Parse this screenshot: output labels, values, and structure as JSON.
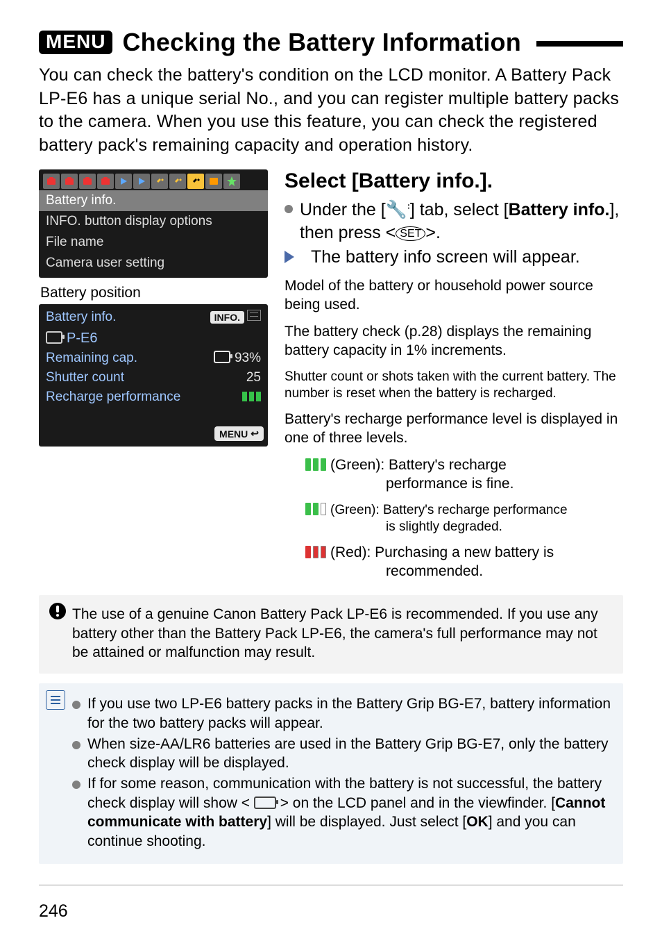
{
  "header": {
    "menu_badge": "MENU",
    "title": "Checking the Battery Information"
  },
  "intro": "You can check the battery's condition on the LCD monitor. A Battery Pack LP-E6 has a unique serial No., and you can register multiple battery packs to the camera. When you use this feature, you can check the registered battery pack's remaining capacity and operation history.",
  "menu_screen": {
    "items": [
      "Battery info.",
      "INFO. button display options",
      "File name",
      "Camera user setting"
    ],
    "selected_index": 0
  },
  "battery_position_label": "Battery position",
  "info_screen": {
    "title": "Battery info.",
    "info_label": "INFO.",
    "model_label": "P-E6",
    "remaining_label": "Remaining cap.",
    "remaining_value": "93%",
    "shutter_label": "Shutter count",
    "shutter_value": "25",
    "recharge_label": "Recharge performance",
    "menu_label": "MENU"
  },
  "step": {
    "title": "Select [Battery info.].",
    "line1_pre": "Under the [",
    "line1_mid": "] tab, select [",
    "line1_bold": "Battery info.",
    "line1_post": "], then press <",
    "line1_end": ">.",
    "line2": "The battery info screen will appear."
  },
  "annotations": {
    "model": "Model of the battery or household power source being used.",
    "remaining": "The battery check (p.28) displays the remaining battery capacity in 1% increments.",
    "shutter": "Shutter count or shots taken with the current battery. The number is reset when the battery is recharged.",
    "recharge_intro": "Battery's recharge performance level is displayed in one of three levels.",
    "lvl_fine_a": "(Green): Battery's recharge",
    "lvl_fine_b": "performance is fine.",
    "lvl_deg_a": "(Green): Battery's recharge performance",
    "lvl_deg_b": "is slightly degraded.",
    "lvl_red_a": "(Red): Purchasing a new battery is",
    "lvl_red_b": "recommended."
  },
  "note_warning": "The use of a genuine Canon Battery Pack LP-E6 is recommended. If you use any battery other than the Battery Pack LP-E6, the camera's full performance may not be attained or malfunction may result.",
  "tips": {
    "t1": "If you use two LP-E6 battery packs in the Battery Grip BG-E7, battery information for the two battery packs will appear.",
    "t2": "When size-AA/LR6 batteries are used in the Battery Grip BG-E7, only the battery check display will be displayed.",
    "t3_a": "If for some reason, communication with the battery is not successful, the battery check display will show < ",
    "t3_b": " > on the LCD panel and in the viewfinder. [",
    "t3_bold": "Cannot communicate with battery",
    "t3_c": "] will be displayed. Just select [",
    "t3_ok": "OK",
    "t3_d": "] and you can continue shooting."
  },
  "page_number": "246"
}
